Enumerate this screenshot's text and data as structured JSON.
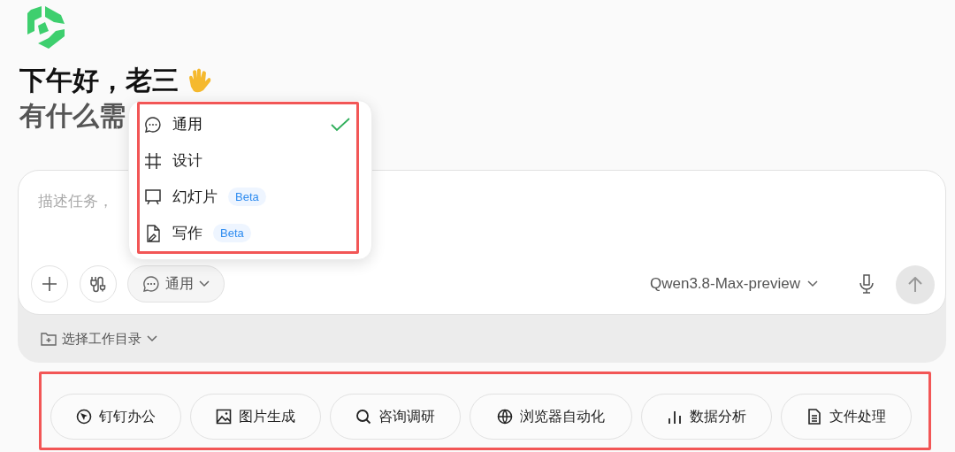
{
  "greeting": "下午好，老三",
  "subtitle": "有什么需",
  "composer": {
    "placeholder": "描述任务，",
    "mode_button": {
      "label": "通用"
    },
    "model": "Qwen3.8-Max-preview"
  },
  "workspace": {
    "label": "选择工作目录"
  },
  "mode_menu": {
    "items": [
      {
        "label": "通用",
        "kind": "chat",
        "selected": true
      },
      {
        "label": "设计",
        "kind": "grid",
        "selected": false
      },
      {
        "label": "幻灯片",
        "kind": "slides",
        "selected": false,
        "badge": "Beta"
      },
      {
        "label": "写作",
        "kind": "writing",
        "selected": false,
        "badge": "Beta"
      }
    ]
  },
  "quick_actions": [
    {
      "label": "钉钉办公",
      "kind": "dingtalk"
    },
    {
      "label": "图片生成",
      "kind": "image"
    },
    {
      "label": "咨询调研",
      "kind": "search"
    },
    {
      "label": "浏览器自动化",
      "kind": "globe"
    },
    {
      "label": "数据分析",
      "kind": "chart"
    },
    {
      "label": "文件处理",
      "kind": "file"
    }
  ]
}
